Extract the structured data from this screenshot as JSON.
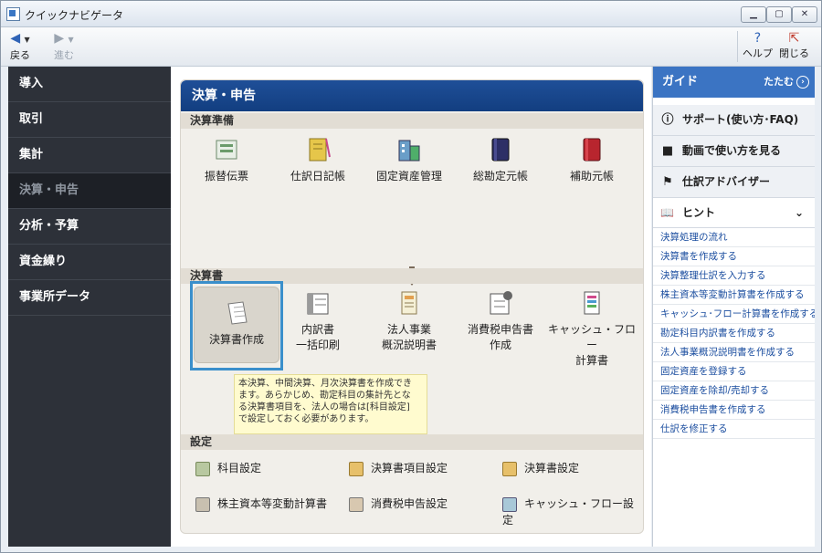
{
  "window": {
    "title": "クイックナビゲータ",
    "minimize": "▁",
    "maximize": "▢",
    "close": "✕"
  },
  "toolbar": {
    "back": "戻る",
    "forward": "進む",
    "help": "ヘルプ",
    "close": "閉じる"
  },
  "sidebar": {
    "items": [
      {
        "label": "導入"
      },
      {
        "label": "取引"
      },
      {
        "label": "集計"
      },
      {
        "label": "決算・申告"
      },
      {
        "label": "分析・予算"
      },
      {
        "label": "資金繰り"
      },
      {
        "label": "事業所データ"
      }
    ]
  },
  "main": {
    "title": "決算・申告",
    "prep": {
      "label": "決算準備",
      "items": [
        {
          "label": "振替伝票"
        },
        {
          "label": "仕訳日記帳"
        },
        {
          "label": "固定資産管理"
        },
        {
          "label": "総勘定元帳"
        },
        {
          "label": "補助元帳"
        }
      ]
    },
    "statements": {
      "label": "決算書",
      "items": [
        {
          "label": "決算書作成"
        },
        {
          "line1": "内訳書",
          "line2": "一括印刷"
        },
        {
          "line1": "法人事業",
          "line2": "概況説明書"
        },
        {
          "line1": "消費税申告書",
          "line2": "作成"
        },
        {
          "line1": "キャッシュ・フロー",
          "line2": "計算書"
        }
      ]
    },
    "tooltip": [
      "本決算、中間決算、月次決算書を作成でき",
      "ます。あらかじめ、勘定科目の集計先とな",
      "る決算書項目を、法人の場合は[科目設定]",
      "で設定しておく必要があります。"
    ],
    "settings": {
      "label": "設定",
      "items": [
        {
          "label": "科目設定"
        },
        {
          "label": "決算書項目設定"
        },
        {
          "label": "決算書設定"
        },
        {
          "label": "株主資本等変動計算書"
        },
        {
          "label": "消費税申告設定"
        },
        {
          "label": "キャッシュ・フロー設定"
        }
      ]
    }
  },
  "guide": {
    "title": "ガイド",
    "collapse": "たたむ",
    "buttons": [
      {
        "label": "サポート(使い方･FAQ)"
      },
      {
        "label": "動画で使い方を見る"
      },
      {
        "label": "仕訳アドバイザー"
      }
    ],
    "hint": "ヒント",
    "links": [
      "決算処理の流れ",
      "決算書を作成する",
      "決算整理仕訳を入力する",
      "株主資本等変動計算書を作成する",
      "キャッシュ･フロー計算書を作成する",
      "勘定科目内訳書を作成する",
      "法人事業概況説明書を作成する",
      "固定資産を登録する",
      "固定資産を除却/売却する",
      "消費税申告書を作成する",
      "仕訳を修正する"
    ]
  },
  "colors": {
    "header": "#1f4f98",
    "guide": "#3b74c3",
    "highlight": "#3a8fcb",
    "sidebar": "#2d3139"
  }
}
